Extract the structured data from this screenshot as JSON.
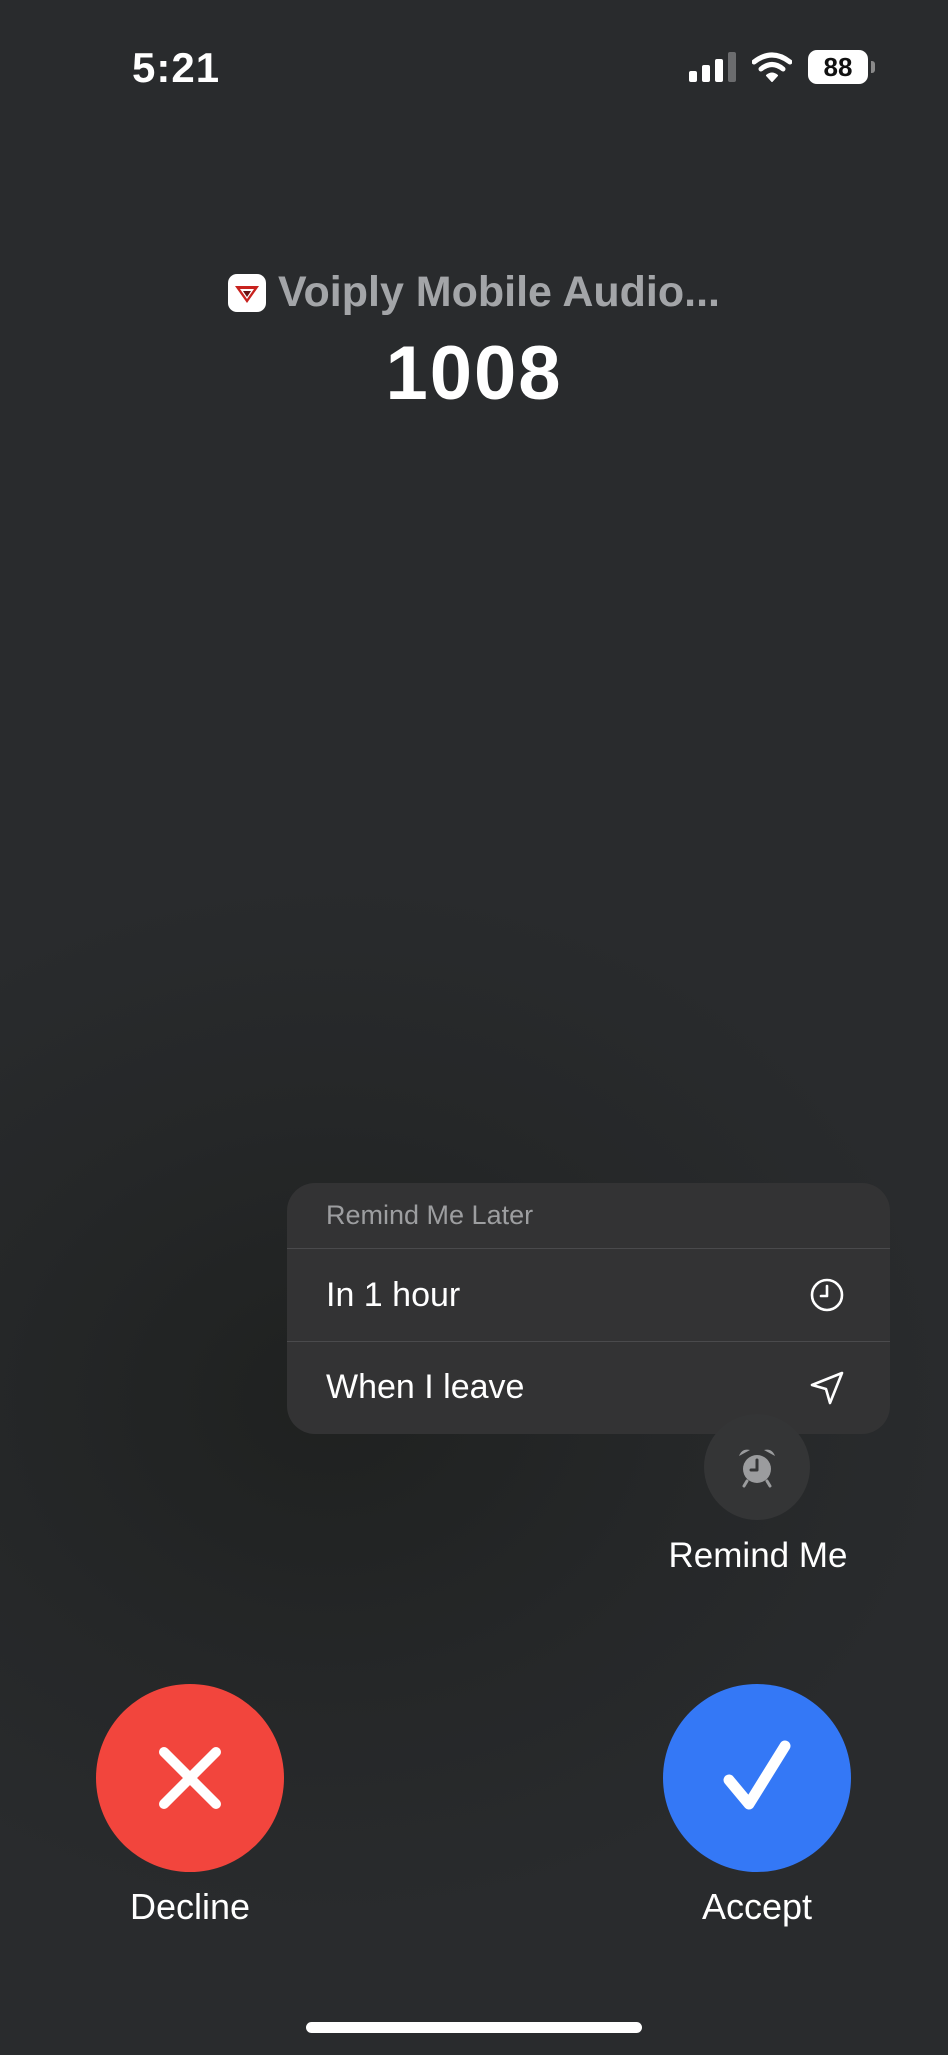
{
  "status_bar": {
    "time": "5:21",
    "battery_percent": "88",
    "signal_icon": "cellular-signal-icon",
    "wifi_icon": "wifi-icon"
  },
  "caller": {
    "app_name": "Voiply Mobile Audio...",
    "number": "1008"
  },
  "remind_menu": {
    "title": "Remind Me Later",
    "items": [
      {
        "label": "In 1 hour",
        "icon": "clock-icon"
      },
      {
        "label": "When I leave",
        "icon": "location-arrow-icon"
      }
    ]
  },
  "actions": {
    "remind_label": "Remind Me",
    "decline_label": "Decline",
    "accept_label": "Accept"
  },
  "colors": {
    "decline": "#f2453d",
    "accept": "#3478f6",
    "background": "#272a2b"
  }
}
